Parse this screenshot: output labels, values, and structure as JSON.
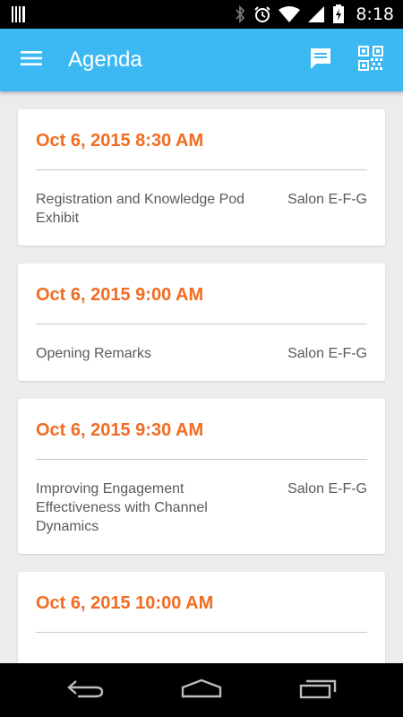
{
  "status_bar": {
    "time": "8:18",
    "icons": [
      "barcode-notification-icon",
      "bluetooth-icon",
      "alarm-icon",
      "wifi-icon",
      "signal-icon",
      "battery-charging-icon"
    ]
  },
  "app_bar": {
    "title": "Agenda",
    "color": "#3cb8f3",
    "icons": [
      "menu-icon",
      "chat-icon",
      "qr-code-icon"
    ]
  },
  "agenda": {
    "accent_color": "#f26c22",
    "items": [
      {
        "date": "Oct 6, 2015 8:30 AM",
        "title": "Registration and Knowledge Pod Exhibit",
        "room": "Salon E-F-G"
      },
      {
        "date": "Oct 6, 2015 9:00 AM",
        "title": "Opening Remarks",
        "room": "Salon E-F-G"
      },
      {
        "date": "Oct 6, 2015 9:30 AM",
        "title": "Improving Engagement Effectiveness with Channel Dynamics",
        "room": "Salon E-F-G"
      },
      {
        "date": "Oct 6, 2015 10:00 AM",
        "title": "",
        "room": ""
      }
    ]
  },
  "nav_bar": {
    "icons": [
      "back-icon",
      "home-icon",
      "recents-icon"
    ]
  }
}
